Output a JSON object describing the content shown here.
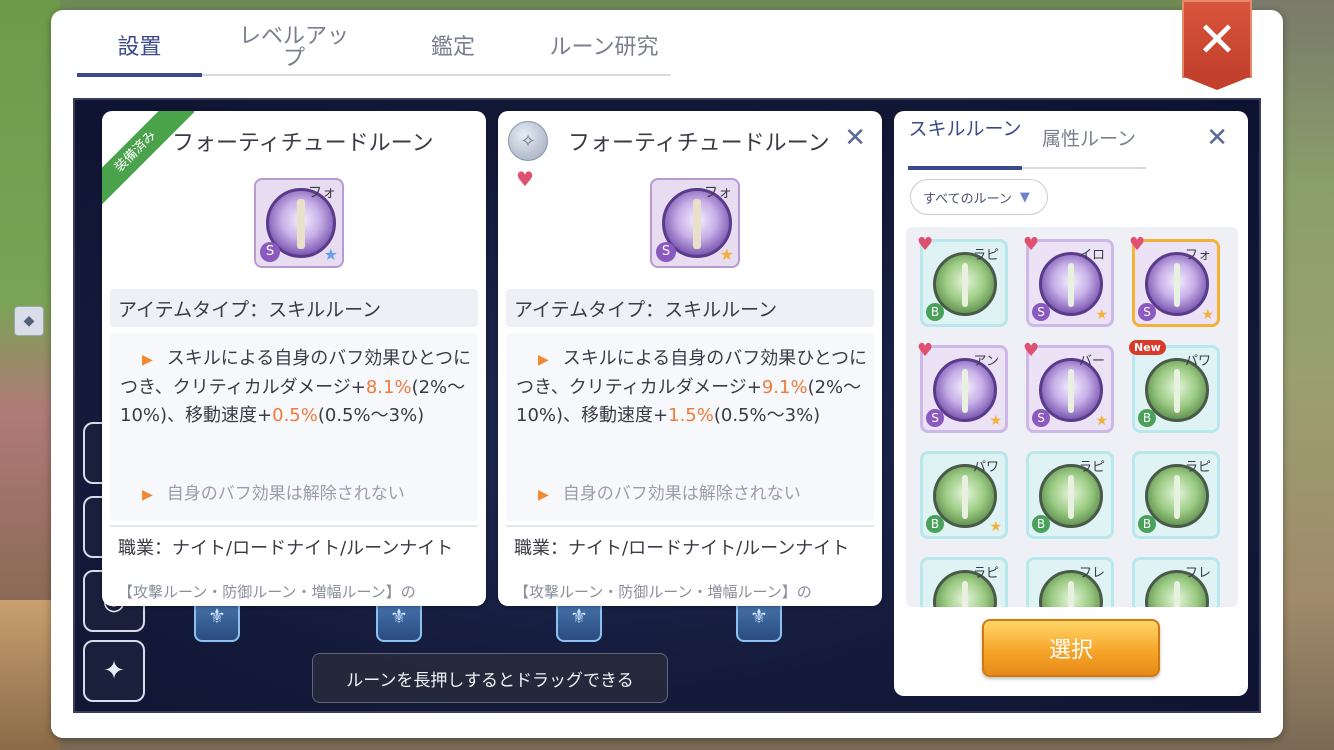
{
  "tabs": [
    {
      "label": "設置"
    },
    {
      "label": "レベルアップ"
    },
    {
      "label": "鑑定"
    },
    {
      "label": "ルーン研究"
    }
  ],
  "close_label": "✕",
  "hint": "ルーンを長押しするとドラッグできる",
  "left_card": {
    "equipped_badge": "装備済み",
    "title": "フォーティチュードルーン",
    "rune_corner": "フォ",
    "grade": "S",
    "star": "★",
    "item_type": "アイテムタイプ：スキルルーン",
    "desc_pre": "スキルによる自身のバフ効果ひとつにつき、クリティカルダメージ+",
    "crit_value": "8.1%",
    "crit_range": "(2%〜10%)、移動速度+",
    "speed_value": "0.5%",
    "speed_range": "(0.5%〜3%)",
    "sub_desc": "自身のバフ効果は解除されない",
    "job": "職業：ナイト/ロードナイト/ルーンナイト",
    "cut_text": "【攻撃ルーン・防御ルーン・増幅ルーン】の"
  },
  "right_card": {
    "title": "フォーティチュードルーン",
    "rune_corner": "フォ",
    "grade": "S",
    "star": "★",
    "item_type": "アイテムタイプ：スキルルーン",
    "desc_pre": "スキルによる自身のバフ効果ひとつにつき、クリティカルダメージ+",
    "crit_value": "9.1%",
    "crit_range": "(2%〜10%)、移動速度+",
    "speed_value": "1.5%",
    "speed_range": "(0.5%〜3%)",
    "sub_desc": "自身のバフ効果は解除されない",
    "job": "職業：ナイト/ロードナイト/ルーンナイト",
    "cut_text": "【攻撃ルーン・防御ルーン・増幅ルーン】の"
  },
  "inventory": {
    "tab_skill": "スキルルーン",
    "tab_attr": "属性ルーン",
    "filter": "すべてのルーン",
    "select_button": "選択",
    "new_badge": "New",
    "runes": [
      {
        "label": "ラピ",
        "grade": "B",
        "favorite": true
      },
      {
        "label": "イロ",
        "grade": "S",
        "favorite": true
      },
      {
        "label": "フォ",
        "grade": "S",
        "favorite": true
      },
      {
        "label": "アン",
        "grade": "S",
        "favorite": true
      },
      {
        "label": "バー",
        "grade": "S",
        "favorite": true
      },
      {
        "label": "パワ",
        "grade": "B",
        "favorite": false
      },
      {
        "label": "パワ",
        "grade": "B",
        "favorite": false
      },
      {
        "label": "ラピ",
        "grade": "B",
        "favorite": false
      },
      {
        "label": "ラピ",
        "grade": "B",
        "favorite": false
      },
      {
        "label": "ラピ",
        "grade": "B",
        "favorite": false
      },
      {
        "label": "フレ",
        "grade": "B",
        "favorite": false
      },
      {
        "label": "フレ",
        "grade": "B",
        "favorite": false
      }
    ]
  },
  "colors": {
    "accent": "#3a4a8a",
    "highlight": "#f07a3a",
    "button": "#f6a62a",
    "close_ribbon": "#c2402c"
  }
}
